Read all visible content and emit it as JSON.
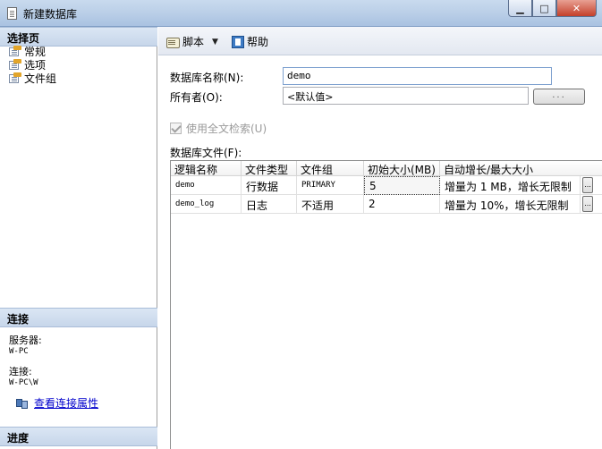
{
  "window": {
    "title": "新建数据库"
  },
  "left": {
    "select_page_header": "选择页",
    "nav_items": [
      {
        "label": "常规",
        "icon": "page-icon"
      },
      {
        "label": "选项",
        "icon": "page-icon"
      },
      {
        "label": "文件组",
        "icon": "page-icon"
      }
    ],
    "connection_header": "连接",
    "server_label": "服务器:",
    "server_value": "W-PC",
    "connection_label": "连接:",
    "connection_value": "W-PC\\W",
    "view_props_link": "查看连接属性",
    "progress_header": "进度"
  },
  "toolbar": {
    "script_label": "脚本",
    "help_label": "帮助"
  },
  "form": {
    "db_name_label": "数据库名称(N):",
    "db_name_value": "demo",
    "owner_label": "所有者(O):",
    "owner_value": "<默认值>",
    "browse_label": "...",
    "fulltext_label": "使用全文检索(U)",
    "fulltext_checked": true,
    "files_label": "数据库文件(F):"
  },
  "files_table": {
    "columns": [
      "逻辑名称",
      "文件类型",
      "文件组",
      "初始大小(MB)",
      "自动增长/最大大小"
    ],
    "rows": [
      {
        "logical_name": "demo",
        "file_type": "行数据",
        "filegroup": "PRIMARY",
        "initial_size": "5",
        "autogrowth": "增量为 1 MB，增长无限制",
        "button": "..."
      },
      {
        "logical_name": "demo_log",
        "file_type": "日志",
        "filegroup": "不适用",
        "initial_size": "2",
        "autogrowth": "增量为 10%，增长无限制",
        "button": "..."
      }
    ]
  }
}
